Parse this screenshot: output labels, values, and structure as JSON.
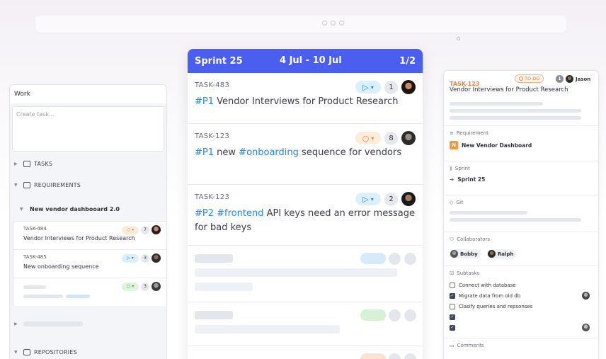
{
  "left": {
    "title": "Work",
    "create_placeholder": "Create task...",
    "sections": {
      "tasks": "TASKS",
      "requirements": "REQUIREMENTS",
      "repositories": "REPOSITORIES"
    },
    "group_title": "New vendor dashbooard 2.0",
    "tasks": [
      {
        "key": "TASK-484",
        "title": "Vendor Interviews for Product Research",
        "count": "7",
        "status": "todo"
      },
      {
        "key": "TASK-485",
        "title": "New onboarding sequence",
        "count": "3",
        "status": "in-progress"
      },
      {
        "key": "",
        "title": "",
        "count": "3",
        "status": "done"
      }
    ]
  },
  "sprint": {
    "name": "Sprint 25",
    "dates": "4 Jul - 10 Jul",
    "page": "1/2",
    "tasks": [
      {
        "key": "TASK-483",
        "priority": "#P1",
        "tag": "",
        "pre": "",
        "text": "Vendor Interviews for Product Research",
        "count": "1",
        "status": "in-progress"
      },
      {
        "key": "TASK-123",
        "priority": "#P1",
        "pre": "new",
        "tag": "#onboarding",
        "text": "sequence for vendors",
        "count": "8",
        "status": "todo"
      },
      {
        "key": "TASK-123",
        "priority": "#P2",
        "pre": "",
        "tag": "#frontend",
        "text": "API keys need an error message for bad keys",
        "count": "2",
        "status": "in-progress"
      }
    ]
  },
  "detail": {
    "key": "TASK-123",
    "status": "TO DO",
    "count": "1",
    "assignee": "Jason",
    "title": "Vendor Interviews for Product Research",
    "requirement_label": "Requirement",
    "requirement_badge": "N",
    "requirement_value": "New Vendor Dashboard",
    "sprint_label": "Sprint",
    "sprint_value": "Sprint 25",
    "git_label": "Git",
    "collaborators_label": "Collaborators",
    "collaborators": [
      "Bobby",
      "Ralph"
    ],
    "subtasks_label": "Subtasks",
    "subtasks": [
      {
        "text": "Connect with database",
        "done": false
      },
      {
        "text": "Migrate data from old db",
        "done": true
      },
      {
        "text": "Clasify queries and repsonses",
        "done": false
      },
      {
        "text": "",
        "done": true
      },
      {
        "text": "",
        "done": true
      }
    ],
    "comments_label": "Comments"
  },
  "colors": {
    "accent": "#4a5ff0",
    "tag": "#2b86d9",
    "todo": "#e8823a",
    "in_progress": "#2b86d9",
    "done": "#3aa34a"
  }
}
